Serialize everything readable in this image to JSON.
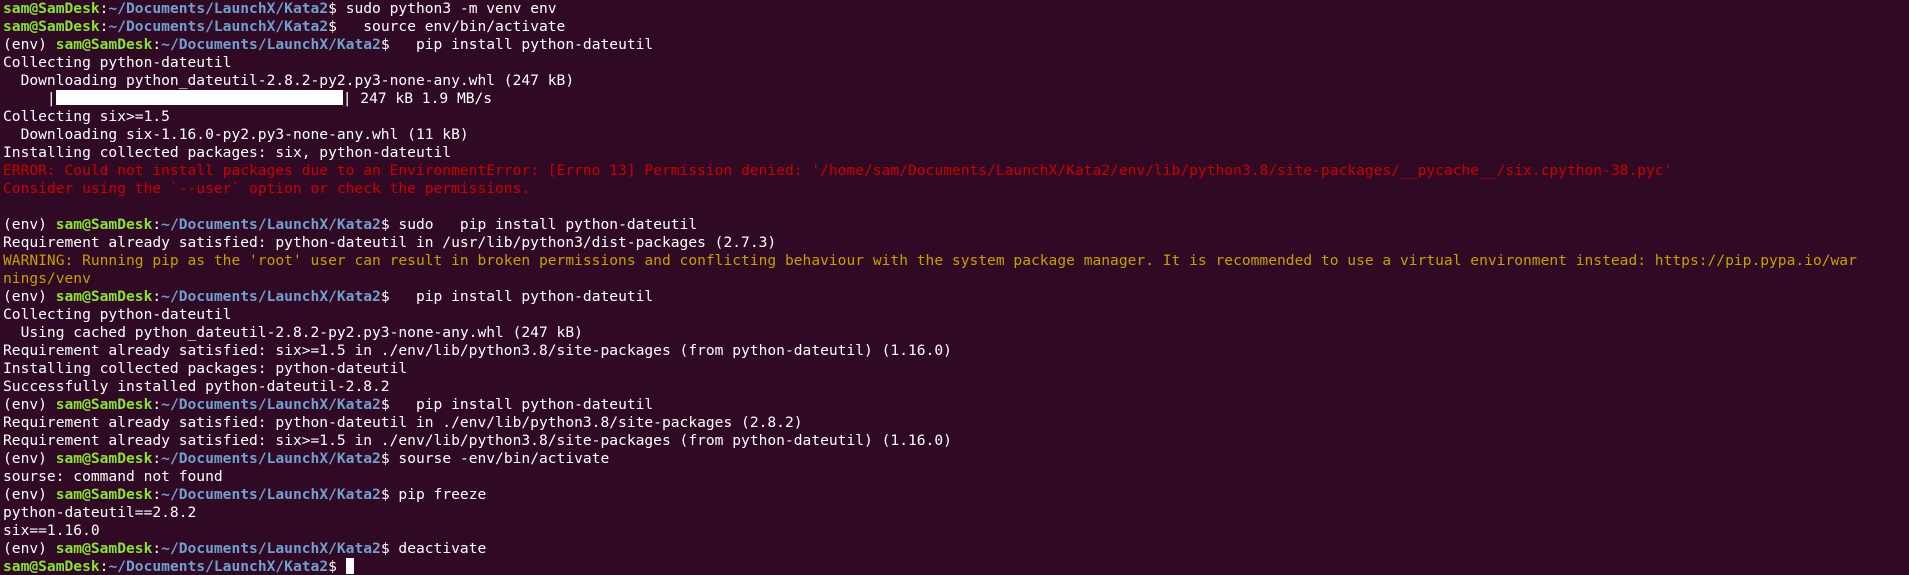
{
  "terminal": {
    "prompt_user": "sam@SamDesk",
    "prompt_path": "~/Documents/LaunchX/Kata2",
    "prompt_sep": ":",
    "prompt_end": "$",
    "env_prefix": "(env) ",
    "colors": {
      "background": "#300a24",
      "text": "#ffffff",
      "user": "#8ae234",
      "path": "#729fcf",
      "error": "#cc0000",
      "warning": "#c4a000"
    },
    "lines": [
      {
        "type": "prompt",
        "env": false,
        "cmd": " sudo python3 -m venv env"
      },
      {
        "type": "prompt",
        "env": false,
        "cmd": "   source env/bin/activate"
      },
      {
        "type": "prompt",
        "env": true,
        "cmd": "   pip install python-dateutil"
      },
      {
        "type": "out",
        "text": "Collecting python-dateutil"
      },
      {
        "type": "out",
        "text": "  Downloading python_dateutil-2.8.2-py2.py3-none-any.whl (247 kB)"
      },
      {
        "type": "progress",
        "prefix": "     |",
        "fraction": 1.0,
        "suffix": "| 247 kB 1.9 MB/s"
      },
      {
        "type": "out",
        "text": "Collecting six>=1.5"
      },
      {
        "type": "out",
        "text": "  Downloading six-1.16.0-py2.py3-none-any.whl (11 kB)"
      },
      {
        "type": "out",
        "text": "Installing collected packages: six, python-dateutil"
      },
      {
        "type": "err",
        "text": "ERROR: Could not install packages due to an EnvironmentError: [Errno 13] Permission denied: '/home/sam/Documents/LaunchX/Kata2/env/lib/python3.8/site-packages/__pycache__/six.cpython-38.pyc'"
      },
      {
        "type": "err",
        "text": "Consider using the `--user` option or check the permissions."
      },
      {
        "type": "out",
        "text": ""
      },
      {
        "type": "prompt",
        "env": true,
        "cmd": " sudo   pip install python-dateutil"
      },
      {
        "type": "out",
        "text": "Requirement already satisfied: python-dateutil in /usr/lib/python3/dist-packages (2.7.3)"
      },
      {
        "type": "warn",
        "text": "WARNING: Running pip as the 'root' user can result in broken permissions and conflicting behaviour with the system package manager. It is recommended to use a virtual environment instead: https://pip.pypa.io/war"
      },
      {
        "type": "warn",
        "text": "nings/venv"
      },
      {
        "type": "prompt",
        "env": true,
        "cmd": "   pip install python-dateutil"
      },
      {
        "type": "out",
        "text": "Collecting python-dateutil"
      },
      {
        "type": "out",
        "text": "  Using cached python_dateutil-2.8.2-py2.py3-none-any.whl (247 kB)"
      },
      {
        "type": "out",
        "text": "Requirement already satisfied: six>=1.5 in ./env/lib/python3.8/site-packages (from python-dateutil) (1.16.0)"
      },
      {
        "type": "out",
        "text": "Installing collected packages: python-dateutil"
      },
      {
        "type": "out",
        "text": "Successfully installed python-dateutil-2.8.2"
      },
      {
        "type": "prompt",
        "env": true,
        "cmd": "   pip install python-dateutil"
      },
      {
        "type": "out",
        "text": "Requirement already satisfied: python-dateutil in ./env/lib/python3.8/site-packages (2.8.2)"
      },
      {
        "type": "out",
        "text": "Requirement already satisfied: six>=1.5 in ./env/lib/python3.8/site-packages (from python-dateutil) (1.16.0)"
      },
      {
        "type": "prompt",
        "env": true,
        "cmd": " sourse -env/bin/activate"
      },
      {
        "type": "out",
        "text": "sourse: command not found"
      },
      {
        "type": "prompt",
        "env": true,
        "cmd": " pip freeze"
      },
      {
        "type": "out",
        "text": "python-dateutil==2.8.2"
      },
      {
        "type": "out",
        "text": "six==1.16.0"
      },
      {
        "type": "prompt",
        "env": true,
        "cmd": " deactivate"
      },
      {
        "type": "prompt",
        "env": false,
        "cmd": " ",
        "cursor": true
      }
    ]
  }
}
